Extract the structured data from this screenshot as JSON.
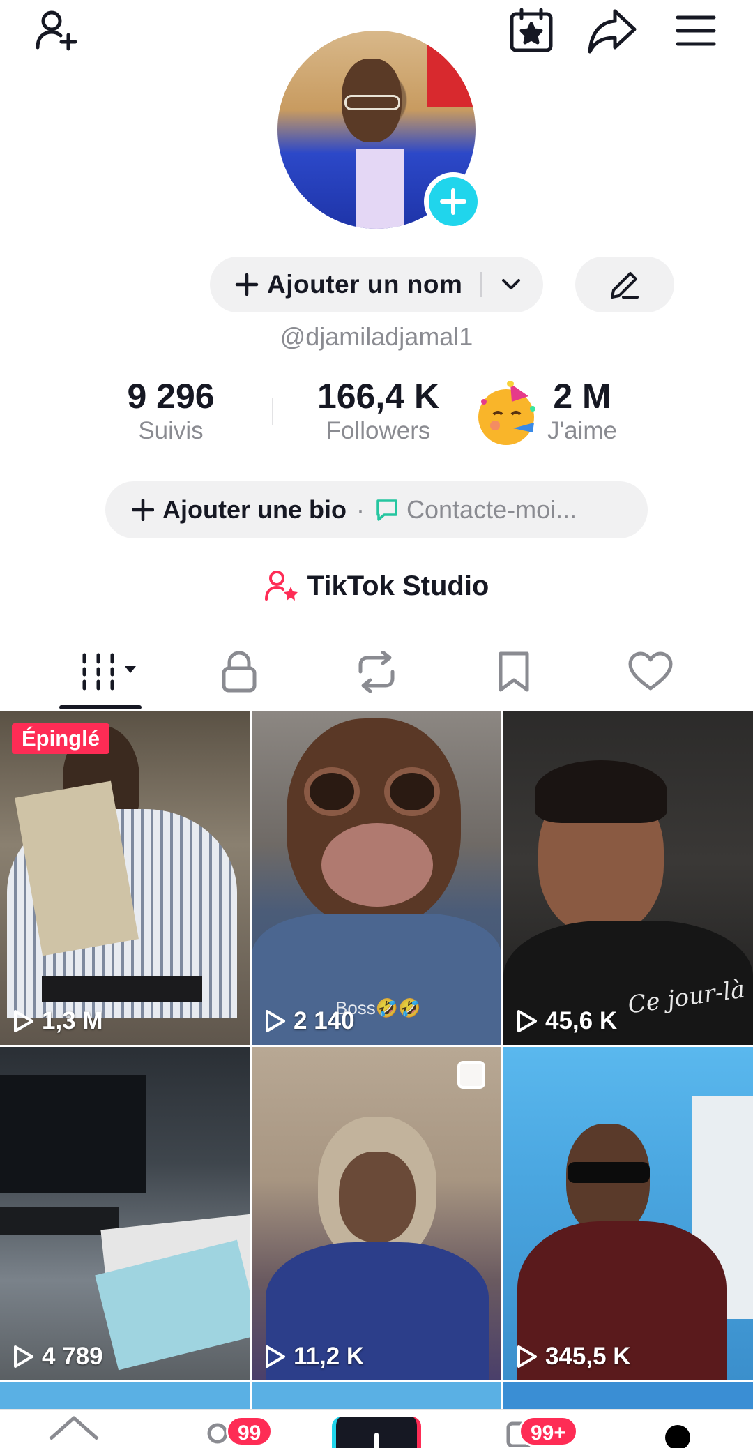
{
  "top_bar": {
    "icons": [
      "add-friend-icon",
      "calendar-star-icon",
      "share-icon",
      "menu-icon"
    ]
  },
  "profile": {
    "add_name_label": "Ajouter un nom",
    "handle": "@djamiladjamal1"
  },
  "stats": [
    {
      "value": "9 296",
      "label": "Suivis"
    },
    {
      "value": "166,4 K",
      "label": "Followers"
    },
    {
      "value": "2 M",
      "label": "J'aime"
    }
  ],
  "bio": {
    "add_label": "Ajouter une bio",
    "separator": "·",
    "contact_label": "Contacte-moi..."
  },
  "studio": {
    "label": "TikTok Studio"
  },
  "tabs": [
    "videos-grid-icon",
    "private-lock-icon",
    "reposts-icon",
    "favorites-bookmark-icon",
    "liked-heart-icon"
  ],
  "videos": [
    {
      "views": "1,3 M",
      "badge": "Épinglé"
    },
    {
      "views": "2 140",
      "caption": "Boss🤣🤣"
    },
    {
      "views": "45,6 K",
      "caption": "Ce jour-là"
    },
    {
      "views": "4 789"
    },
    {
      "views": "11,2 K"
    },
    {
      "views": "345,5 K"
    }
  ],
  "bottom_nav": {
    "inbox_badge": "99",
    "activity_badge": "99+"
  },
  "colors": {
    "accent_red": "#fe2c55",
    "accent_cyan": "#20d5ec",
    "text_primary": "#161823",
    "text_secondary": "#8a8b91",
    "pill_bg": "#f1f1f2"
  }
}
